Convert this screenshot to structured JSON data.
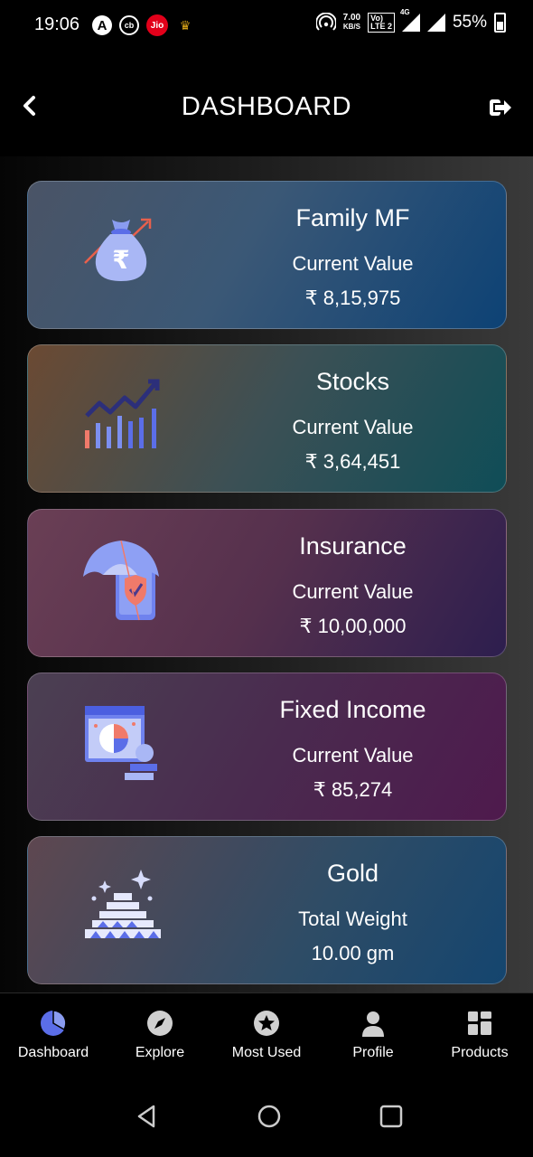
{
  "status_bar": {
    "time": "19:06",
    "left_icons": [
      "A",
      "cb",
      "Jio",
      "RCB"
    ],
    "speed_value": "7.00",
    "speed_unit": "KB/S",
    "volte_top": "Vo)",
    "volte_bottom": "LTE 2",
    "network": "4G",
    "battery_percent": "55%"
  },
  "header": {
    "title": "DASHBOARD",
    "back_icon": "chevron-left-icon",
    "logout_icon": "logout-icon"
  },
  "cards": [
    {
      "title": "Family MF",
      "subtitle": "Current Value",
      "value": "₹ 8,15,975",
      "icon": "money-bag-growth-icon"
    },
    {
      "title": "Stocks",
      "subtitle": "Current Value",
      "value": "₹ 3,64,451",
      "icon": "stocks-chart-icon"
    },
    {
      "title": "Insurance",
      "subtitle": "Current Value",
      "value": "₹ 10,00,000",
      "icon": "insurance-umbrella-icon"
    },
    {
      "title": "Fixed Income",
      "subtitle": "Current Value",
      "value": "₹ 85,274",
      "icon": "fixed-income-icon"
    },
    {
      "title": "Gold",
      "subtitle": "Total Weight",
      "value": "10.00 gm",
      "icon": "gold-bars-icon"
    }
  ],
  "bottom_nav": [
    {
      "label": "Dashboard",
      "icon": "pie-chart-icon",
      "active": true
    },
    {
      "label": "Explore",
      "icon": "compass-icon",
      "active": false
    },
    {
      "label": "Most Used",
      "icon": "star-icon",
      "active": false
    },
    {
      "label": "Profile",
      "icon": "user-icon",
      "active": false
    },
    {
      "label": "Products",
      "icon": "grid-icon",
      "active": false
    }
  ],
  "colors": {
    "accent": "#5b6ee8",
    "nav_inactive": "#d0d0d0",
    "background": "#000000"
  }
}
